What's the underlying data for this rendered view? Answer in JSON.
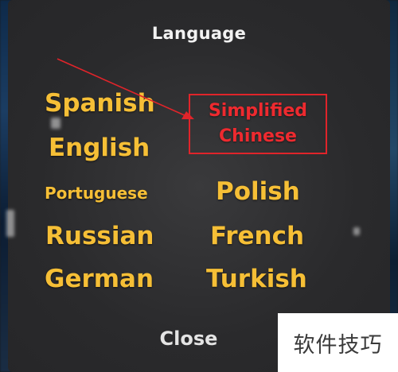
{
  "dialog": {
    "title": "Language",
    "close_label": "Close"
  },
  "languages": {
    "spanish": "Spanish",
    "english": "English",
    "portuguese": "Portuguese",
    "russian": "Russian",
    "german": "German",
    "simplified_chinese_line1": "Simplified",
    "simplified_chinese_line2": "Chinese",
    "polish": "Polish",
    "french": "French",
    "turkish": "Turkish"
  },
  "annotation": {
    "highlight_color": "#e0242a"
  },
  "colors": {
    "language_text": "#f6bf36",
    "title_text": "#f2f2f2",
    "panel_bg": "#2b2b2d"
  },
  "watermark": {
    "text": "软件技巧"
  }
}
